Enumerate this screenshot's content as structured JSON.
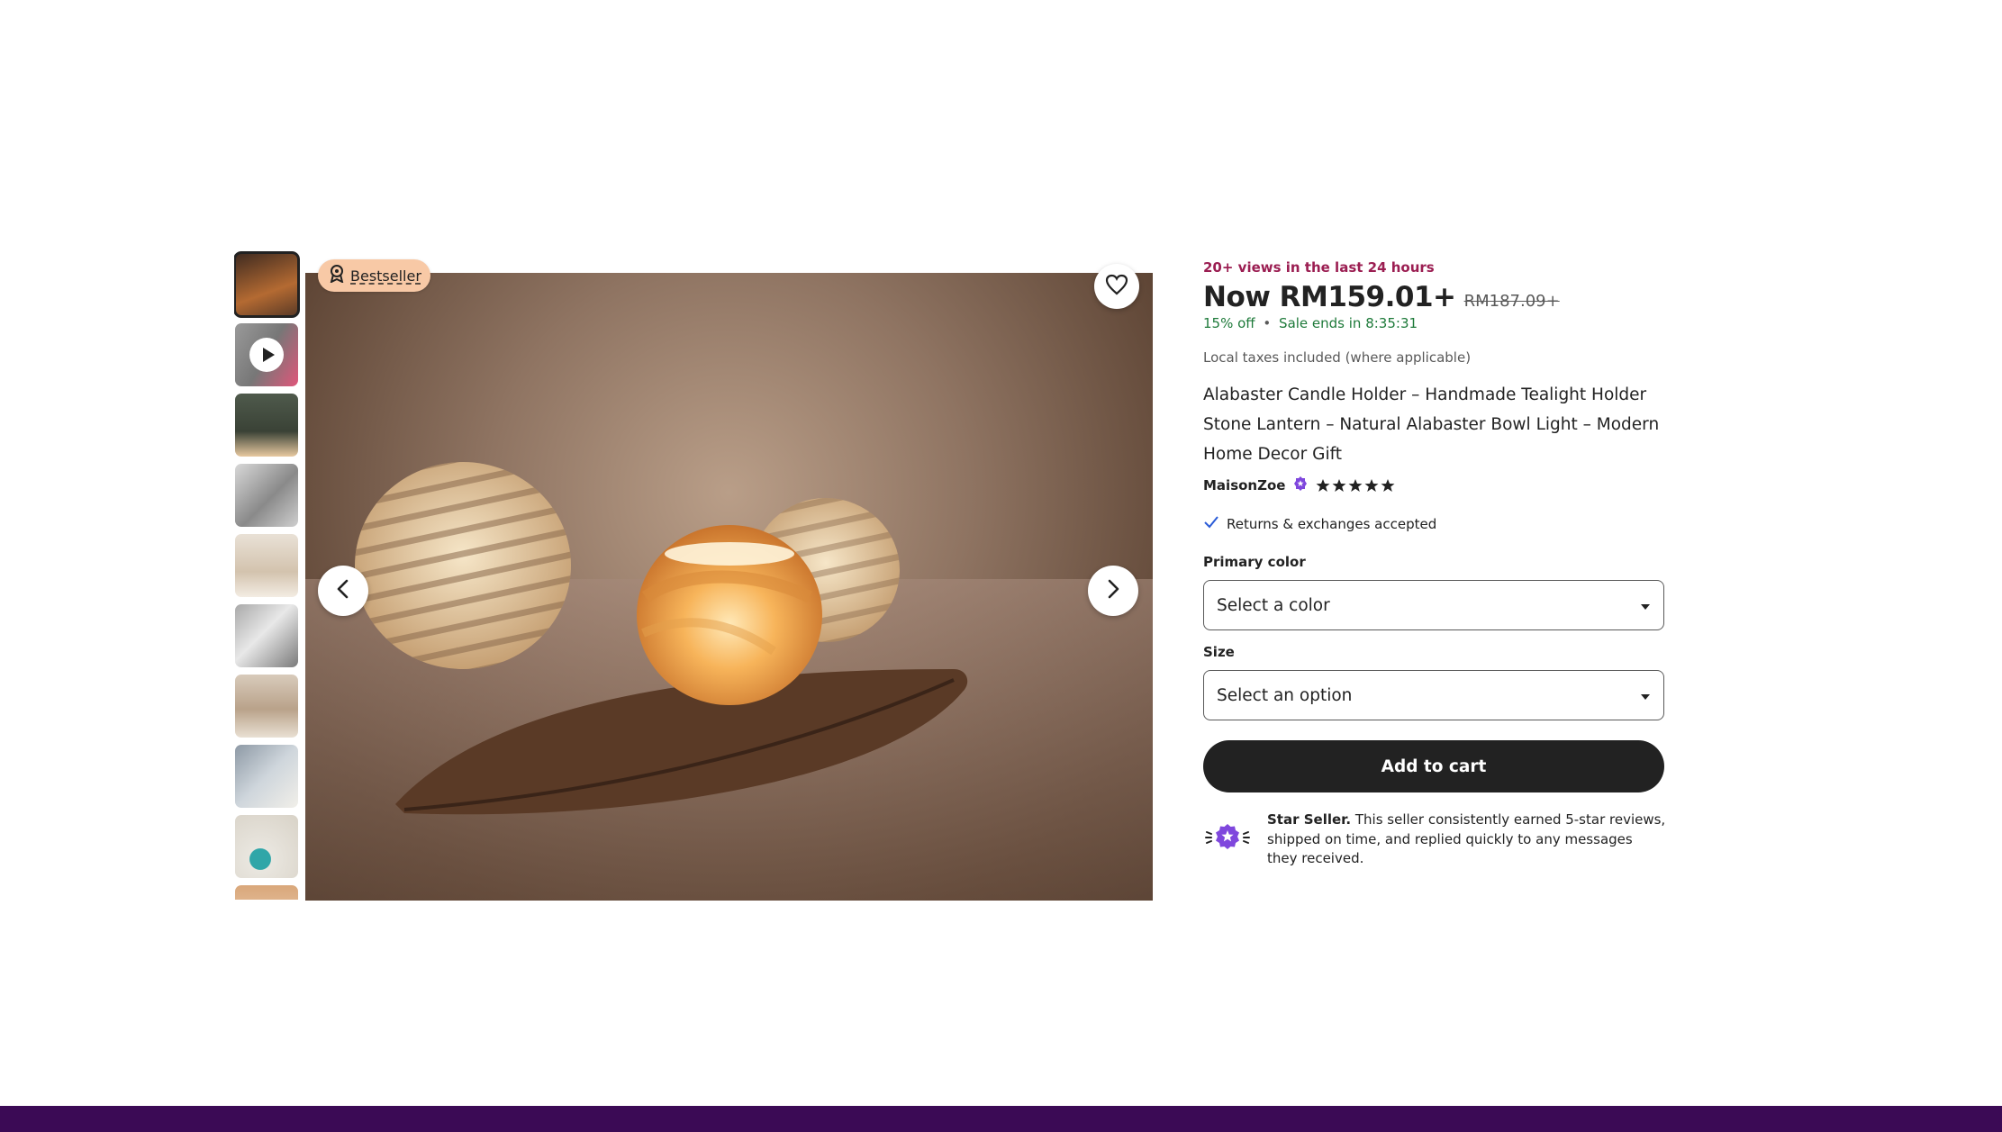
{
  "colors": {
    "accent_views": "#9b1e52",
    "sale_green": "#1e7a3a",
    "badge_bg": "#f8c9a6",
    "footer": "#3b0a55",
    "button_dark": "#222222"
  },
  "gallery": {
    "badge_label": "Bestseller",
    "badge_icon": "award-icon",
    "thumbnail_count_visible": 10,
    "prev_icon": "chevron-left-icon",
    "next_icon": "chevron-right-icon",
    "favorite_icon": "heart-icon"
  },
  "product": {
    "views_text": "20+ views in the last 24 hours",
    "price": "Now RM159.01+",
    "old_price": "RM187.09+",
    "discount": "15% off",
    "separator": "•",
    "sale_ends": "Sale ends in 8:35:31",
    "taxes_note": "Local taxes included (where applicable)",
    "title": "Alabaster Candle Holder – Handmade Tealight Holder Stone Lantern – Natural Alabaster Bowl Light – Modern Home Decor Gift",
    "seller_name": "MaisonZoe",
    "rating_stars": 5,
    "returns_text": "Returns & exchanges accepted"
  },
  "options": {
    "color_label": "Primary color",
    "color_value": "Select a color",
    "size_label": "Size",
    "size_value": "Select an option"
  },
  "cart": {
    "button_label": "Add to cart"
  },
  "star_seller": {
    "title": "Star Seller.",
    "description": " This seller consistently earned 5-star reviews, shipped on time, and replied quickly to any messages they received."
  }
}
